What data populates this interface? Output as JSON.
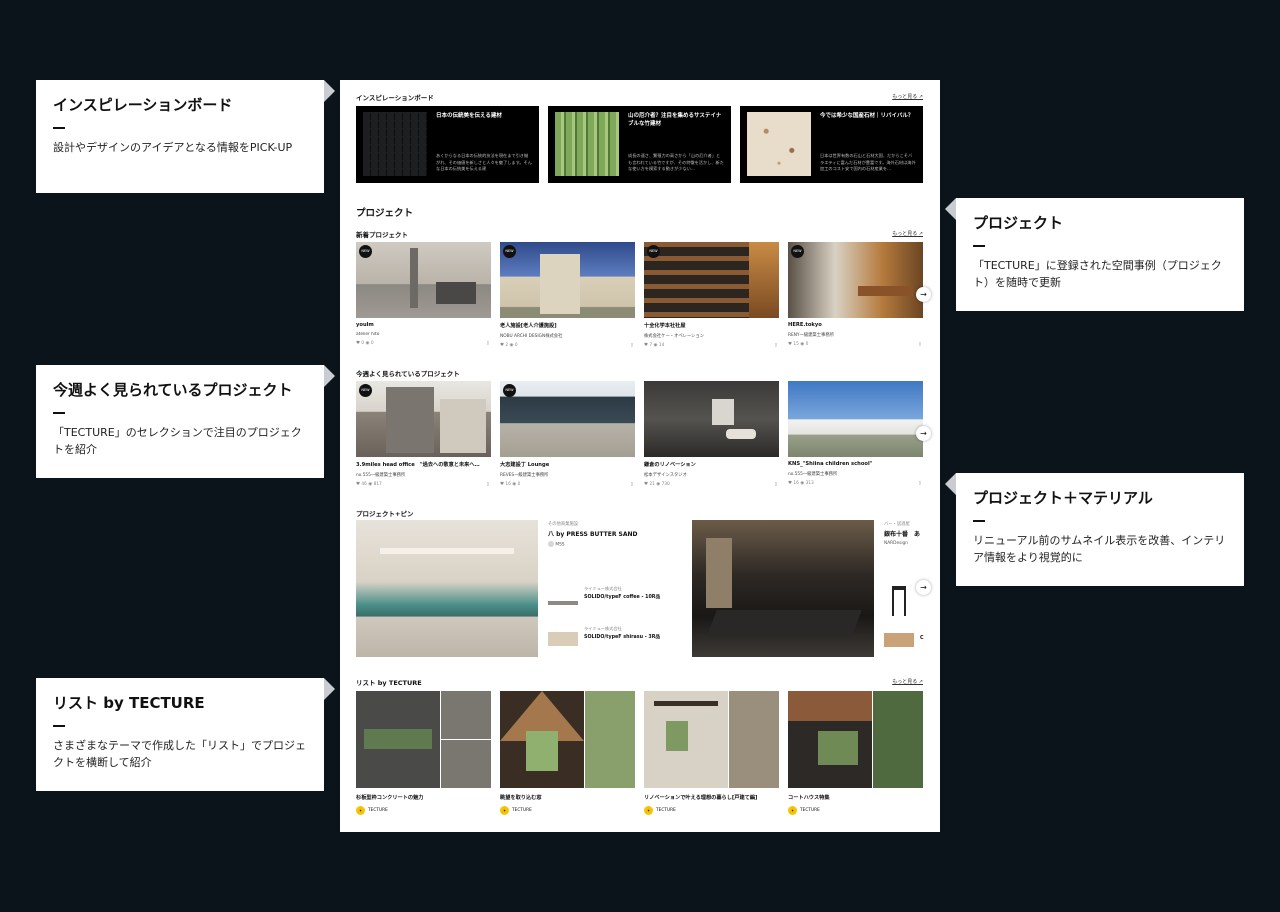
{
  "callouts": [
    {
      "title": "インスピレーションボード",
      "desc": "設計やデザインのアイデアとなる情報をPICK-UP"
    },
    {
      "title": "プロジェクト",
      "desc": "「TECTURE」に登録された空間事例（プロジェクト）を随時で更新"
    },
    {
      "title": "今週よく見られているプロジェクト",
      "desc": "「TECTURE」のセレクションで注目のプロジェクトを紹介"
    },
    {
      "title": "プロジェクト＋マテリアル",
      "desc": "リニューアル前のサムネイル表示を改善、インテリア情報をより視覚的に"
    },
    {
      "title": "リスト by TECTURE",
      "desc": "さまざまなテーマで作成した「リスト」でプロジェクトを横断して紹介"
    }
  ],
  "inspiration": {
    "heading": "インスピレーションボード",
    "more": "もっと見る ↗",
    "cards": [
      {
        "title": "日本の伝統美を伝える建材",
        "desc": "あくからなる日本の伝統的技法を現在まで引き継がれ、その価値を新しさと人々を魅了します。そんな日本の伝統美を伝える建"
      },
      {
        "title": "山の厄介者？注目を集めるサステイナブルな竹建材",
        "desc": "成長の速さ、繁殖力の高さから「山の厄介者」とも言われている竹ですが、その特徴を活かし、新たな使い方を模索する動きが少ない…"
      },
      {
        "title": "今では希少な国産石材｜リバイバル？",
        "desc": "日本は世界有数の石山と石材大国、だからこそバラエティに富んだ石材が豊富です。海外石材は海外加工のコスト安で国内の石材産業を…"
      }
    ]
  },
  "projects": {
    "heading": "プロジェクト",
    "new_heading": "新着プロジェクト",
    "more": "もっと見る ↗",
    "new": [
      {
        "title": "youlm",
        "author": "atelier hito",
        "likes": "0",
        "views": "0",
        "new": "NEW"
      },
      {
        "title": "老人施設[老人介護施設]",
        "author": "NOBU ARCHI DESIGN株式会社",
        "likes": "2",
        "views": "0",
        "new": "NEW"
      },
      {
        "title": "十全化学本社社屋",
        "author": "株式会社ケー・オペレーション",
        "likes": "7",
        "views": "14",
        "new": "NEW"
      },
      {
        "title": "HERE.tokyo",
        "author": "RENY一級建築士事務所",
        "likes": "15",
        "views": "0",
        "new": "NEW"
      }
    ]
  },
  "weekly": {
    "heading": "今週よく見られているプロジェクト",
    "items": [
      {
        "title": "3.9miles head office　\"過去への敬意と未来へ…",
        "author": "no.555一級建築士事務所",
        "likes": "46",
        "views": "817",
        "new": "NEW"
      },
      {
        "title": "大志建設丁 Lounge",
        "author": "REVES一級建築士事務所",
        "likes": "16",
        "views": "0",
        "new": "NEW"
      },
      {
        "title": "鎌倉のリノベーション",
        "author": "松本デザインスタジオ",
        "likes": "21",
        "views": "730",
        "new": ""
      },
      {
        "title": "KNS_\"Shiina children school\"",
        "author": "no.555一級建築士事務所",
        "likes": "16",
        "views": "313",
        "new": ""
      }
    ]
  },
  "pin": {
    "heading": "プロジェクト+ピン",
    "items": [
      {
        "category": "その他商業施設",
        "title": "八 by PRESS BUTTER SAND",
        "author": "MSS",
        "materials": [
          {
            "company": "ライミュー株式会社",
            "name": "SOLIDO/typeF coffee - 10R品"
          },
          {
            "company": "ライミュー株式会社",
            "name": "SOLIDO/typeF shirasu - 3R品"
          }
        ]
      },
      {
        "category": "バー・居酒屋",
        "title": "銀布十番　あ",
        "author": "NARDesign",
        "materials": [
          {
            "company": "",
            "name": "C"
          }
        ]
      }
    ]
  },
  "lists": {
    "heading": "リスト by TECTURE",
    "more": "もっと見る ↗",
    "items": [
      {
        "title": "杉板型枠コンクリートの魅力",
        "author": "TECTURE"
      },
      {
        "title": "眺望を取り込む窓",
        "author": "TECTURE"
      },
      {
        "title": "リノベーションで叶える理想の暮らし[戸建て編]",
        "author": "TECTURE"
      },
      {
        "title": "コートハウス特集",
        "author": "TECTURE"
      }
    ]
  },
  "icons": {
    "heart": "♥",
    "eye": "◉",
    "bookmark": "▯",
    "arrow": "→"
  }
}
